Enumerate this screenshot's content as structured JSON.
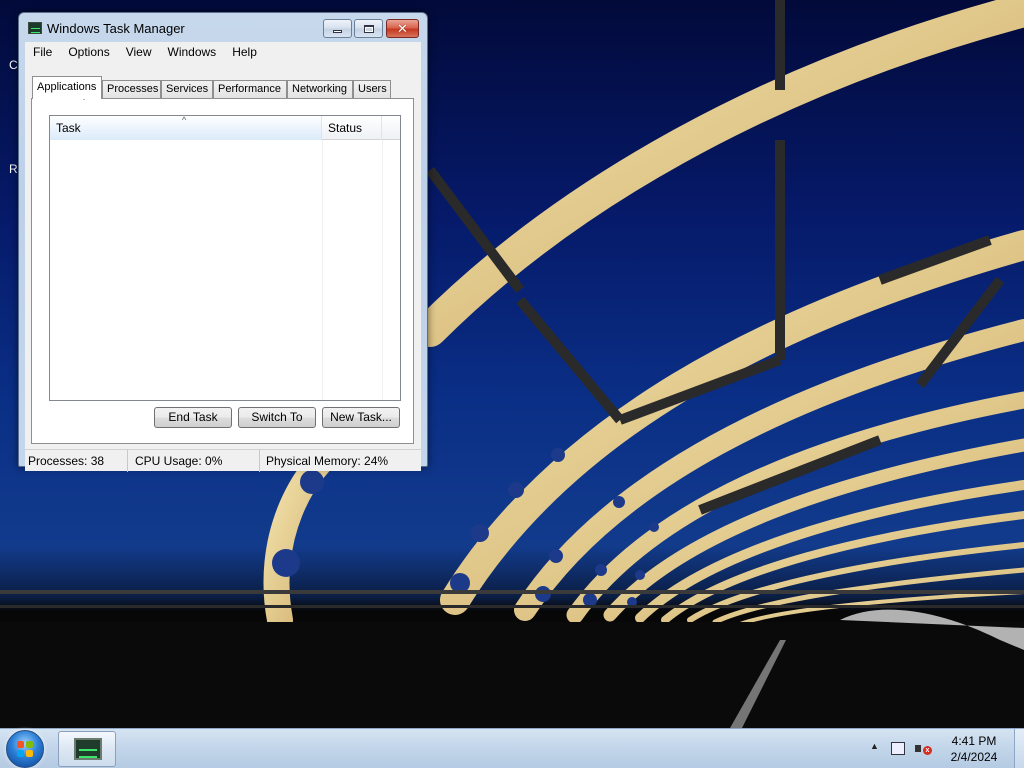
{
  "desktop": {
    "edge_letters": [
      "C",
      "R"
    ]
  },
  "window": {
    "title": "Windows Task Manager",
    "icon": "task-manager-icon",
    "controls": {
      "minimize": "minimize-icon",
      "maximize": "maximize-icon",
      "close": "close-icon"
    }
  },
  "menu": [
    "File",
    "Options",
    "View",
    "Windows",
    "Help"
  ],
  "tabs": [
    {
      "label": "Applications",
      "selected": true
    },
    {
      "label": "Processes",
      "selected": false
    },
    {
      "label": "Services",
      "selected": false
    },
    {
      "label": "Performance",
      "selected": false
    },
    {
      "label": "Networking",
      "selected": false
    },
    {
      "label": "Users",
      "selected": false
    }
  ],
  "applications": {
    "columns": [
      "Task",
      "Status"
    ],
    "sort_indicator": "^",
    "rows": [],
    "buttons": {
      "end_task": "End Task",
      "switch_to": "Switch To",
      "new_task": "New Task..."
    }
  },
  "statusbar": {
    "processes": "Processes: 38",
    "cpu": "CPU Usage: 0%",
    "memory": "Physical Memory: 24%"
  },
  "taskbar": {
    "start": "start-orb",
    "running_app": "task-manager-icon",
    "tray_icons": [
      "show-hidden-icons-arrow",
      "network-icon",
      "volume-muted-icon"
    ],
    "time": "4:41 PM",
    "date": "2/4/2024"
  },
  "colors": {
    "taskbar": "#c3d6ea",
    "window_frame": "#bcd0e8",
    "close_button": "#c4391f"
  }
}
